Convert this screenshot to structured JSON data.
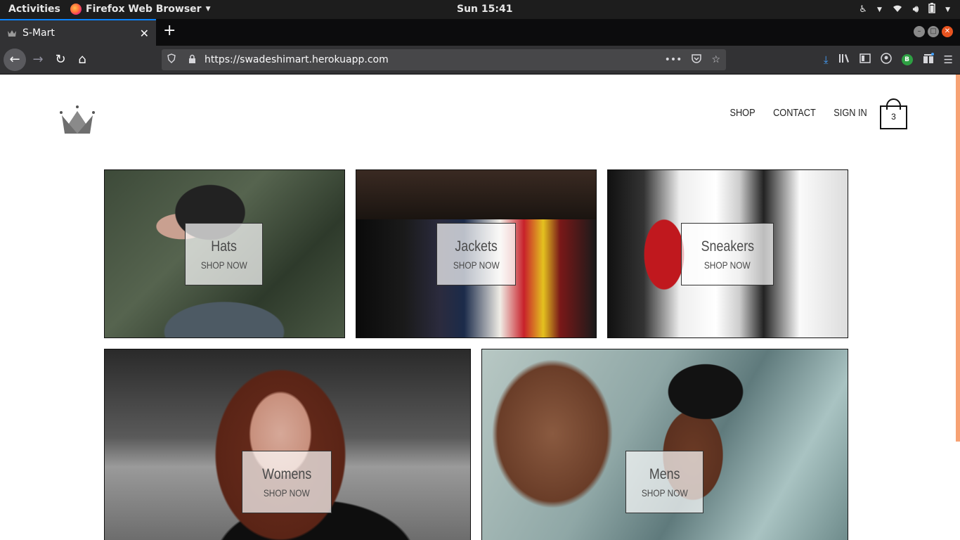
{
  "system_bar": {
    "activities": "Activities",
    "app_name": "Firefox Web Browser",
    "clock": "Sun 15:41"
  },
  "browser": {
    "tab_title": "S-Mart",
    "url": "https://swadeshimart.herokuapp.com",
    "accent_color": "#0a84ff",
    "extension_badge": "B"
  },
  "site": {
    "nav": {
      "shop": "SHOP",
      "contact": "CONTACT",
      "sign_in": "SIGN IN"
    },
    "cart_count": "3",
    "categories": [
      {
        "name": "Hats",
        "cta": "SHOP NOW"
      },
      {
        "name": "Jackets",
        "cta": "SHOP NOW"
      },
      {
        "name": "Sneakers",
        "cta": "SHOP NOW"
      },
      {
        "name": "Womens",
        "cta": "SHOP NOW"
      },
      {
        "name": "Mens",
        "cta": "SHOP NOW"
      }
    ]
  }
}
